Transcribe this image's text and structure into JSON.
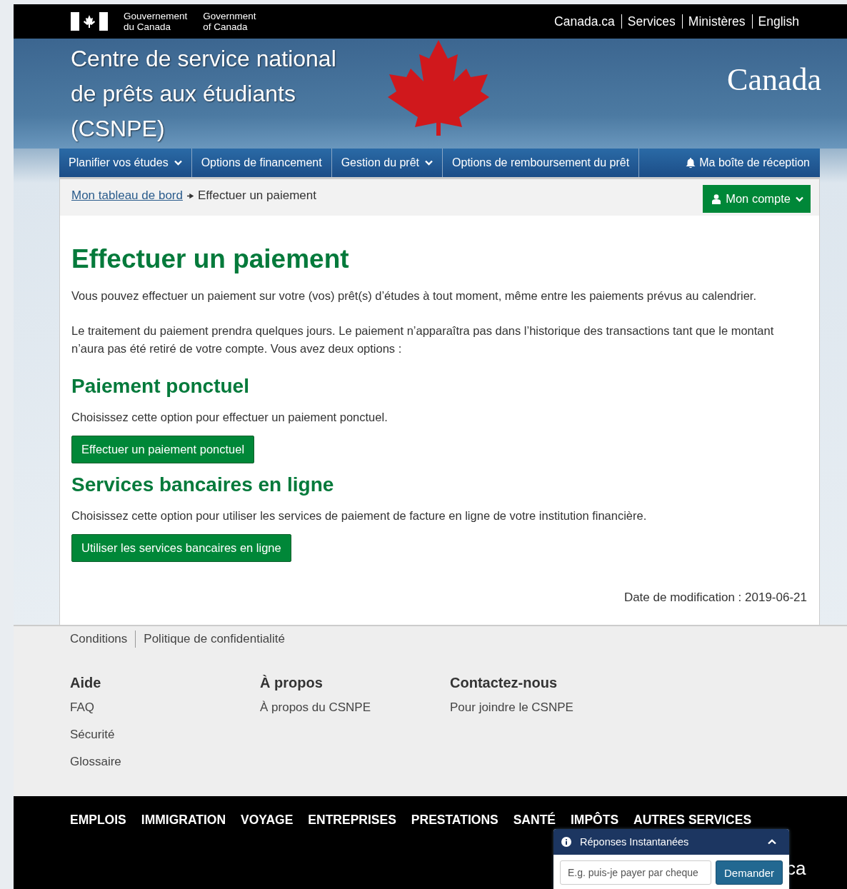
{
  "gov_bar": {
    "signature_fr": [
      "Gouvernement",
      "du Canada"
    ],
    "signature_en": [
      "Government",
      "of Canada"
    ],
    "links": [
      "Canada.ca",
      "Services",
      "Ministères",
      "English"
    ]
  },
  "banner": {
    "title": "Centre de service national de prêts aux étudiants (CSNPE)",
    "wordmark": "Canada"
  },
  "nav": [
    {
      "label": "Planifier vos études",
      "dropdown": true
    },
    {
      "label": "Options de financement",
      "dropdown": false
    },
    {
      "label": "Gestion du prêt",
      "dropdown": true
    },
    {
      "label": "Options de remboursement du prêt",
      "dropdown": false
    },
    {
      "label": "Ma boîte de réception",
      "dropdown": false,
      "kind": "inbox"
    }
  ],
  "breadcrumb": {
    "link": "Mon tableau de bord",
    "current": "Effectuer un paiement"
  },
  "account_button": "Mon compte",
  "page": {
    "title": "Effectuer un paiement",
    "intro": [
      "Vous pouvez effectuer un paiement sur votre (vos) prêt(s) d’études à tout moment, même entre les paiements prévus au calendrier.",
      "Le traitement du paiement prendra quelques jours. Le paiement n’apparaîtra pas dans l’historique des transactions tant que le montant n’aura pas été retiré de votre compte. Vous avez deux options :"
    ],
    "sections": [
      {
        "heading": "Paiement ponctuel",
        "text": "Choisissez cette option pour effectuer un paiement ponctuel.",
        "button": "Effectuer un paiement ponctuel"
      },
      {
        "heading": "Services bancaires en ligne",
        "text": "Choisissez cette option pour utiliser les services de paiement de facture en ligne de votre institution financière.",
        "button": "Utiliser les services bancaires en ligne"
      }
    ],
    "modified": "Date de modification : 2019-06-21"
  },
  "footer": {
    "links": [
      "Conditions",
      "Politique de confidentialité"
    ],
    "columns": [
      {
        "heading": "Aide",
        "links": [
          "FAQ",
          "Sécurité",
          "Glossaire"
        ]
      },
      {
        "heading": "À propos",
        "links": [
          "À propos du CSNPE"
        ]
      },
      {
        "heading": "Contactez-nous",
        "links": [
          "Pour joindre le CSNPE"
        ]
      }
    ],
    "themes": [
      "EMPLOIS",
      "IMMIGRATION",
      "VOYAGE",
      "ENTREPRISES",
      "PRESTATIONS",
      "SANTÉ",
      "IMPÔTS",
      "AUTRES SERVICES"
    ],
    "wordmark_fragment": "ca"
  },
  "chat": {
    "title": "Réponses Instantanées",
    "placeholder": "E.g. puis-je payer par cheque",
    "button": "Demander"
  }
}
